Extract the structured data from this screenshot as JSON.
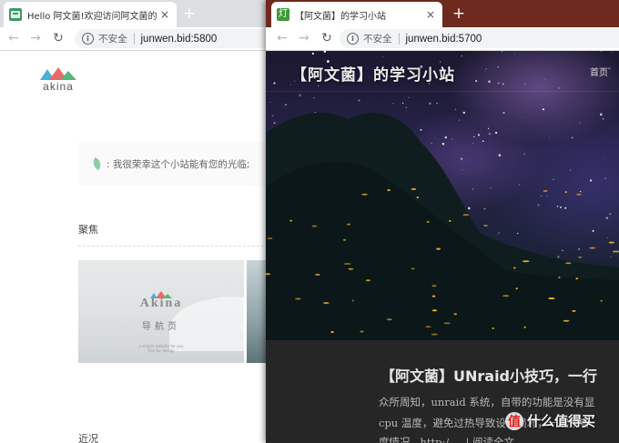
{
  "window_left": {
    "tab": {
      "title": "Hello 阿文菌!欢迎访问阿文菌的",
      "close": "×"
    },
    "new_tab": "+",
    "nav": {
      "back": "←",
      "forward": "→",
      "reload": "↻"
    },
    "address": {
      "info": "i",
      "insecure": "不安全",
      "url": "junwen.bid:5800"
    },
    "page": {
      "logo_text": "akina",
      "notice_text": ": 我很荣幸这个小站能有您的光临;",
      "focus_title": "聚焦",
      "card": {
        "title": "Akina",
        "subtitle": "导航页",
        "fine1": "a simple website for you",
        "fine2": "free for design"
      },
      "recent_title": "近况"
    }
  },
  "window_right": {
    "tab": {
      "favicon": "灯",
      "title": "【阿文菌】的学习小站",
      "close": "×"
    },
    "new_tab": "+",
    "nav": {
      "back": "←",
      "forward": "→",
      "reload": "↻"
    },
    "address": {
      "info": "i",
      "insecure": "不安全",
      "url": "junwen.bid:5700"
    },
    "page": {
      "site_title": "【阿文菌】的学习小站",
      "home_link": "首页",
      "post_title": "【阿文菌】UNraid小技巧，一行",
      "excerpt_lines": [
        "众所周知，unraid 系统，自带的功能是没有显",
        "cpu 温度，避免过热导致设备损坏，一起来看",
        "度情况...http:/ ... | 阅读全文"
      ]
    }
  },
  "watermark": {
    "badge": "值",
    "text": "什么值得买"
  },
  "colors": {
    "right_tabstrip": "#6e2a1e",
    "left_tabstrip": "#dcdedf",
    "page_dark": "#262626"
  }
}
